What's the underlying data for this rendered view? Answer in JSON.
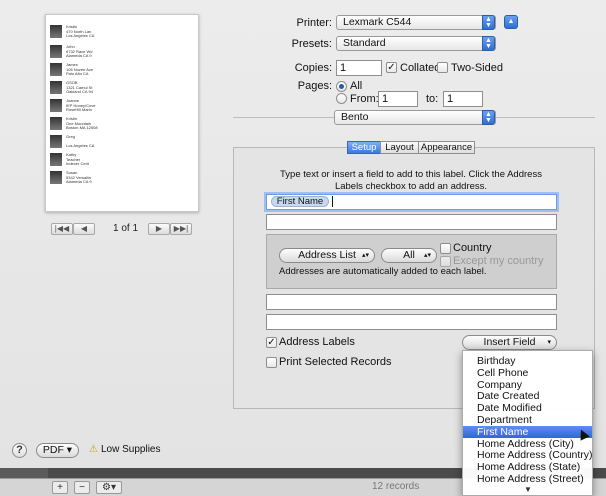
{
  "background": {
    "records": "12 records",
    "add_label": "+",
    "remove_label": "−",
    "gear_label": "⚙▾"
  },
  "preview": {
    "page_info": "1 of 1",
    "first": "|◀◀",
    "prev": "◀",
    "next": "▶",
    "last": "▶▶|",
    "entries": [
      "Kristin\n470 North Lan\nLos Angeles CA",
      "John\n6732 Race Wd\nAlameda CA 9",
      "James\n106 Nozee Ave\nPalo Alto CA",
      "GSOB\n1321 Camul St\nOakland CA 94",
      "Joanne\nIEP Honey/Cove\nRoseHill Marin",
      "Kristin\nOne Mountain\nBoston MA 12508",
      "Greg\n\nLos Angeles CA",
      "Kathy\nTeacher\nIndexer Cerit",
      "Susan\n5342 Versailin\nAlameda CA 9"
    ]
  },
  "print": {
    "printer_label": "Printer:",
    "printer_value": "Lexmark C544",
    "presets_label": "Presets:",
    "presets_value": "Standard",
    "copies_label": "Copies:",
    "copies_value": "1",
    "collated_label": "Collated",
    "two_sided_label": "Two-Sided",
    "pages_label": "Pages:",
    "all_label": "All",
    "from_label": "From:",
    "from_value": "1",
    "to_label": "to:",
    "to_value": "1",
    "app_popup": "Bento"
  },
  "tabs": [
    "Setup",
    "Layout",
    "Appearance"
  ],
  "setup": {
    "instructions": "Type text or insert a field to add to this label. Click the Address Labels checkbox to add an address.",
    "token": "First Name",
    "address_list": "Address List",
    "all_popup": "All",
    "country_label": "Country",
    "except_label": "Except my country",
    "auto_note": "Addresses are automatically added to each label.",
    "address_labels": "Address Labels",
    "print_selected": "Print Selected Records",
    "insert_field": "Insert Field"
  },
  "footer": {
    "help": "?",
    "pdf": "PDF ▾",
    "low_supplies": "Low Supplies"
  },
  "menu": {
    "items": [
      "Birthday",
      "Cell Phone",
      "Company",
      "Date Created",
      "Date Modified",
      "Department",
      "First Name",
      "Home Address (City)",
      "Home Address (Country)",
      "Home Address (State)",
      "Home Address (Street)"
    ],
    "highlighted": "First Name",
    "more": "▼"
  },
  "colors": {
    "accent": "#2f66d8",
    "token": "#c9d8ef",
    "warning": "#d6a000"
  }
}
